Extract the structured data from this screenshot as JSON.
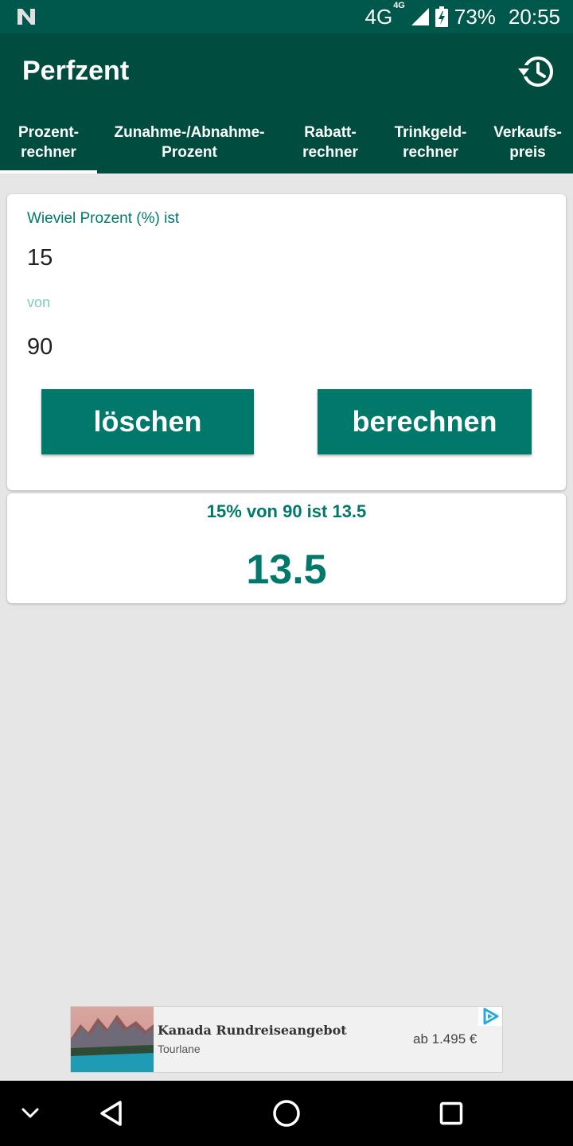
{
  "status_bar": {
    "network": "4G",
    "network_sup": "4G",
    "battery": "73%",
    "time": "20:55",
    "icons": [
      "n-logo-icon",
      "signal-icon",
      "battery-charging-icon"
    ]
  },
  "app_bar": {
    "title": "Perfzent",
    "history_icon": "history-icon"
  },
  "tabs": [
    {
      "label": "Prozent-\nrechner",
      "selected": true
    },
    {
      "label": "Zunahme-/Abnahme-\nProzent",
      "selected": false
    },
    {
      "label": "Rabatt-\nrechner",
      "selected": false
    },
    {
      "label": "Trinkgeld-\nrechner",
      "selected": false
    },
    {
      "label": "Verkaufs-\npreis",
      "selected": false
    }
  ],
  "form": {
    "label_percent": "Wieviel Prozent (%) ist",
    "value_percent": "15",
    "label_of": "von",
    "value_of": "90",
    "clear_button": "löschen",
    "calculate_button": "berechnen"
  },
  "result": {
    "text": "15% von 90 ist 13.5",
    "value": "13.5"
  },
  "ad": {
    "title": "Kanada Rundreiseangebot",
    "advertiser": "Tourlane",
    "price": "ab 1.495 €",
    "choices_icon": "adchoices-icon"
  },
  "nav_bar": {
    "icons": [
      "chevron-down-icon",
      "back-icon",
      "home-icon",
      "recents-icon"
    ]
  },
  "colors": {
    "status_bar": "#00574b",
    "app_bar": "#004d40",
    "accent": "#00796b",
    "hint": "#80cbc4",
    "background": "#e6e6e6"
  }
}
